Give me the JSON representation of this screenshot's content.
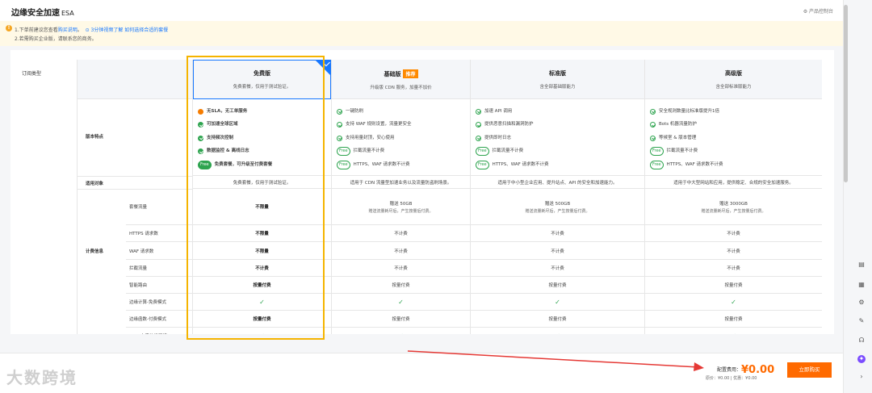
{
  "header": {
    "title": "边缘安全加速",
    "title_en": "ESA",
    "console": "产品控制台"
  },
  "notice": {
    "line1_prefix": "1.下单前建议您查看",
    "line1_link": "购买说明",
    "line1_video": "3分钟视频了解 如何选择合适的套餐",
    "line2": "2.若需购买企业版，请联系您的商务。"
  },
  "labels": {
    "sub_type": "订阅类型",
    "features": "版本特点",
    "target": "适用对象",
    "billing": "计费信息"
  },
  "billing_rows": [
    "套餐流量",
    "HTTPS 请求数",
    "WAF 请求数",
    "拦截流量",
    "智能路由",
    "边缘计算-免费模式",
    "边缘函数-付费模式",
    "CDN 内容分发网络"
  ],
  "plans": [
    {
      "name": "免费版",
      "desc": "免费套餐，仅用于测试验证。",
      "features": [
        {
          "icon": "warn",
          "text": "无SLA，无工单服务"
        },
        {
          "icon": "on",
          "text": "可加速全球区域"
        },
        {
          "icon": "on",
          "text": "支持频次控制"
        },
        {
          "icon": "on",
          "text": "数据监控 & 离线日志"
        },
        {
          "icon": "tagfill",
          "tag": "Free",
          "text": "免费套餐，可升级至付费套餐"
        }
      ],
      "target": "免费套餐，仅用于测试验证。",
      "rows": [
        {
          "main": "不限量"
        },
        {
          "main": "不限量"
        },
        {
          "main": "不限量"
        },
        {
          "main": "不计费"
        },
        {
          "main": "按量付费"
        },
        {
          "main": "✓"
        },
        {
          "main": "按量付费"
        },
        {
          "main": "✓"
        }
      ]
    },
    {
      "name": "基础版",
      "badge": "推荐",
      "desc": "升级版 CDN 服务，加量不加价",
      "features": [
        {
          "icon": "off",
          "text": "一键防刷"
        },
        {
          "icon": "off",
          "text": "支持 WAF 规则设置，流量更安全"
        },
        {
          "icon": "off",
          "text": "支持用量封顶，安心使用"
        },
        {
          "icon": "tag",
          "tag": "Free",
          "text": "拦截流量不计费"
        },
        {
          "icon": "tag",
          "tag": "Free",
          "text": "HTTPS、WAF 请求数不计费"
        }
      ],
      "target": "适用于 CDN 流量型加速业务以及流量防盗刷场景。",
      "rows": [
        {
          "main": "赠送 50GB",
          "sub": "赠送流量耗尽后，产生按量后付费。"
        },
        {
          "main": "不计费"
        },
        {
          "main": "不计费"
        },
        {
          "main": "不计费"
        },
        {
          "main": "按量付费"
        },
        {
          "main": "✓"
        },
        {
          "main": "按量付费"
        },
        {
          "main": "✓"
        }
      ]
    },
    {
      "name": "标准版",
      "desc": "含全部基础版能力",
      "features": [
        {
          "icon": "off",
          "text": "加速 API 调用"
        },
        {
          "icon": "off",
          "text": "提供恶意扫描和漏洞防护"
        },
        {
          "icon": "off",
          "text": "提供即时日志"
        },
        {
          "icon": "tag",
          "tag": "Free",
          "text": "拦截流量不计费"
        },
        {
          "icon": "tag",
          "tag": "Free",
          "text": "HTTPS、WAF 请求数不计费"
        }
      ],
      "target": "适用于中小型企业应用、提升站点、API 的安全和加速能力。",
      "rows": [
        {
          "main": "赠送 500GB",
          "sub": "赠送流量耗尽后，产生按量后付费。"
        },
        {
          "main": "不计费"
        },
        {
          "main": "不计费"
        },
        {
          "main": "不计费"
        },
        {
          "main": "按量付费"
        },
        {
          "main": "✓"
        },
        {
          "main": "按量付费"
        },
        {
          "main": "✓"
        }
      ]
    },
    {
      "name": "高级版",
      "desc": "含全部标准版能力",
      "features": [
        {
          "icon": "off",
          "text": "安全规则数量比标准版提升1倍"
        },
        {
          "icon": "off",
          "text": "Bots 机器流量防护"
        },
        {
          "icon": "off",
          "text": "等候室 & 版本管理"
        },
        {
          "icon": "tag",
          "tag": "Free",
          "text": "拦截流量不计费"
        },
        {
          "icon": "tag",
          "tag": "Free",
          "text": "HTTPS、WAF 请求数不计费"
        }
      ],
      "target": "适用于中大型网站和应用，提供稳定、合规的安全加速服务。",
      "rows": [
        {
          "main": "赠送 3000GB",
          "sub": "赠送流量耗尽后，产生按量后付费。"
        },
        {
          "main": "不计费"
        },
        {
          "main": "不计费"
        },
        {
          "main": "不计费"
        },
        {
          "main": "按量付费"
        },
        {
          "main": "✓"
        },
        {
          "main": "按量付费"
        },
        {
          "main": "✓"
        }
      ]
    }
  ],
  "footer": {
    "cost_label": "配置费用：",
    "cost_amount": "¥0.00",
    "orig": "原价：¥0.00 | 优惠：¥0.00",
    "buy": "立即购买",
    "watermark": "大数跨境"
  },
  "colors": {
    "accent": "#1677ff",
    "orange": "#ff6a00",
    "green": "#2ea44f",
    "highlight": "#f5b400"
  }
}
